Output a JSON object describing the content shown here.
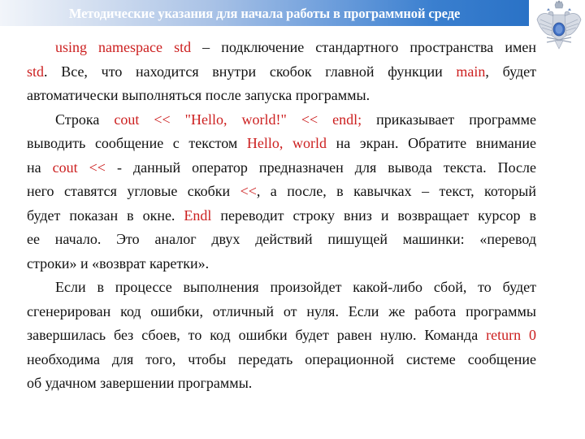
{
  "header": {
    "title": "Методические указания для начала работы в программной среде",
    "emblem_icon": "double-headed-eagle-emblem-icon",
    "gradient_start": "#f2f5fa",
    "gradient_end": "#2a72c6"
  },
  "colors": {
    "text": "#111111",
    "code_highlight": "#cc1f1f"
  },
  "paragraphs": [
    {
      "lines": [
        [
          {
            "t": "using namespace std",
            "code": true
          },
          {
            "t": " – подключение стандартного пространства имен"
          }
        ],
        [
          {
            "t": "std",
            "code": true
          },
          {
            "t": ". Все, что находится внутри скобок главной функции "
          },
          {
            "t": "main",
            "code": true
          },
          {
            "t": ", будет"
          }
        ],
        [
          {
            "t": "автоматически выполняться после запуска программы."
          }
        ]
      ]
    },
    {
      "lines": [
        [
          {
            "t": "Строка "
          },
          {
            "t": "cout << \"Hello, world!\" << endl;",
            "code": true
          },
          {
            "t": " приказывает программе"
          }
        ],
        [
          {
            "t": "выводить сообщение с текстом "
          },
          {
            "t": "Hello, world",
            "code": true
          },
          {
            "t": " на экран. Обратите внимание"
          }
        ],
        [
          {
            "t": "на "
          },
          {
            "t": "cout <<",
            "code": true
          },
          {
            "t": " - данный оператор предназначен для вывода текста. После"
          }
        ],
        [
          {
            "t": "него ставятся угловые скобки "
          },
          {
            "t": "<<",
            "code": true
          },
          {
            "t": ", а после, в кавычках – текст, который"
          }
        ],
        [
          {
            "t": "будет показан в окне. "
          },
          {
            "t": "Endl",
            "code": true
          },
          {
            "t": " переводит строку вниз и возвращает курсор в"
          }
        ],
        [
          {
            "t": "ее начало. Это аналог двух действий пишущей машинки: «перевод"
          }
        ],
        [
          {
            "t": "строки» и «возврат каретки»."
          }
        ]
      ]
    },
    {
      "lines": [
        [
          {
            "t": "Если в процессе выполнения произойдет какой-либо сбой, то будет"
          }
        ],
        [
          {
            "t": "сгенерирован код ошибки, отличный от нуля. Если же работа программы"
          }
        ],
        [
          {
            "t": "завершилась без сбоев, то код ошибки будет равен нулю. Команда "
          },
          {
            "t": "return 0",
            "code": true
          }
        ],
        [
          {
            "t": "необходима для того, чтобы передать операционной системе сообщение"
          }
        ],
        [
          {
            "t": "об удачном завершении программы."
          }
        ]
      ]
    }
  ]
}
